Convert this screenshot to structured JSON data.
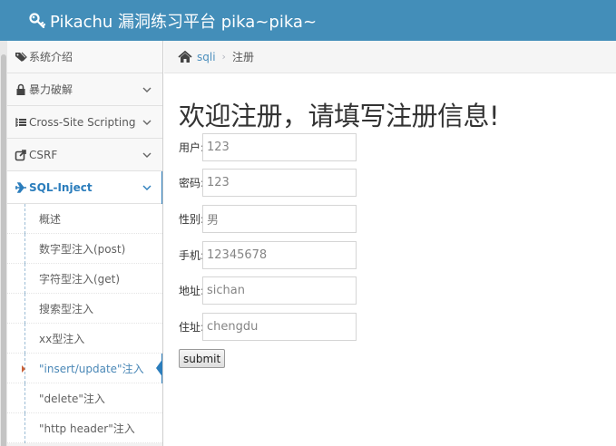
{
  "header": {
    "title": "Pikachu 漏洞练习平台 pika~pika~"
  },
  "sidebar": {
    "items": [
      {
        "label": "系统介绍",
        "icon": "tags-icon",
        "has_chevron": false
      },
      {
        "label": "暴力破解",
        "icon": "lock-icon",
        "has_chevron": true
      },
      {
        "label": "Cross-Site Scripting",
        "icon": "list-icon",
        "has_chevron": true
      },
      {
        "label": "CSRF",
        "icon": "share-icon",
        "has_chevron": true
      },
      {
        "label": "SQL-Inject",
        "icon": "plane-icon",
        "has_chevron": true,
        "active": true
      }
    ],
    "sub_items": [
      {
        "label": "概述"
      },
      {
        "label": "数字型注入(post)"
      },
      {
        "label": "字符型注入(get)"
      },
      {
        "label": "搜索型注入"
      },
      {
        "label": "xx型注入"
      },
      {
        "label": "\"insert/update\"注入",
        "active": true
      },
      {
        "label": "\"delete\"注入"
      },
      {
        "label": "\"http header\"注入"
      }
    ]
  },
  "breadcrumb": {
    "link": "sqli",
    "current": "注册"
  },
  "form": {
    "title": "欢迎注册，请填写注册信息!",
    "fields": [
      {
        "label": "用户:",
        "value": "123"
      },
      {
        "label": "密码:",
        "value": "123"
      },
      {
        "label": "性别:",
        "value": "男"
      },
      {
        "label": "手机:",
        "value": "12345678"
      },
      {
        "label": "地址:",
        "value": "sichan"
      },
      {
        "label": "住址:",
        "value": "chengdu"
      }
    ],
    "submit_label": "submit"
  },
  "colors": {
    "header_bg": "#438eb9",
    "accent": "#2b7dbc",
    "caret": "#c86139"
  }
}
